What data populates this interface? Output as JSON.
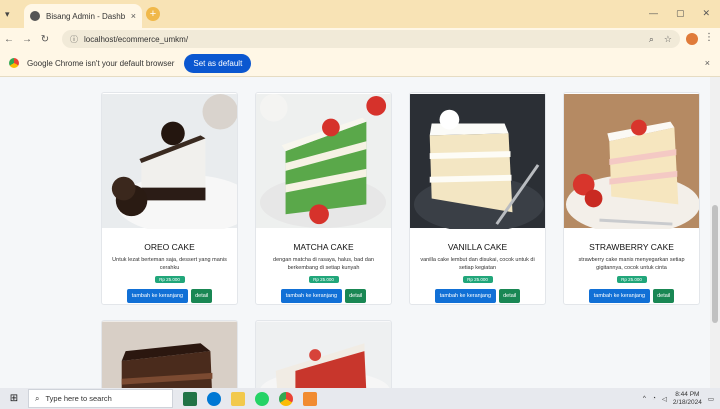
{
  "browser": {
    "tab_title": "Bisang Admin - Dashboard",
    "tab_close": "×",
    "new_tab": "+",
    "url": "localhost/ecommerce_umkm/",
    "infobar_message": "Google Chrome isn't your default browser",
    "infobar_button": "Set as default",
    "infobar_close": "×"
  },
  "products": [
    {
      "name": "OREO CAKE",
      "desc": "Untuk lezat berteman saja, dessert yang manis cerahku",
      "price": "Rp 25.000",
      "cart_label": "tambah ke keranjang",
      "detail_label": "detail"
    },
    {
      "name": "MATCHA CAKE",
      "desc": "dengan matcha di rasaya, halus, bad dan berkembang di setiap kunyah",
      "price": "Rp 25.000",
      "cart_label": "tambah ke keranjang",
      "detail_label": "detail"
    },
    {
      "name": "VANILLA CAKE",
      "desc": "vanilla cake lembut dan disukai, cocok untuk di setiap kegiatan",
      "price": "Rp 25.000",
      "cart_label": "tambah ke keranjang",
      "detail_label": "detail"
    },
    {
      "name": "STRAWBERRY CAKE",
      "desc": "strawberry cake manis menyegarkan setiap gigitannya, cocok untuk cinta",
      "price": "Rp 25.000",
      "cart_label": "tambah ke keranjang",
      "detail_label": "detail"
    }
  ],
  "taskbar": {
    "search_placeholder": "Type here to search",
    "time": "8:44 PM",
    "date": "2/18/2024"
  },
  "colors": {
    "cart_button": "#1170d6",
    "detail_button": "#198754",
    "price_badge": "#21a67a",
    "chrome_bar": "#fff7e6"
  }
}
